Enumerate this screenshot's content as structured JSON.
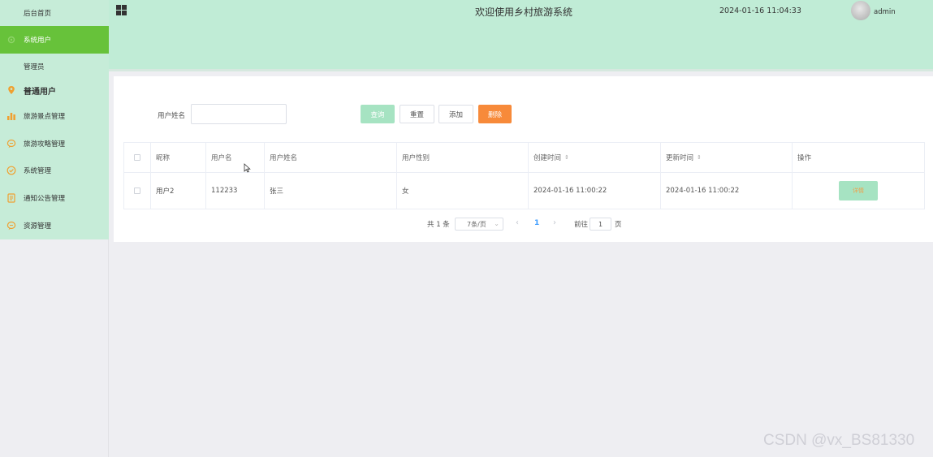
{
  "sidebar": {
    "items": [
      {
        "label": "后台首页",
        "icon": "none"
      },
      {
        "label": "系统用户",
        "icon": "gear-icon",
        "active": true
      },
      {
        "label": "管理员",
        "icon": "none"
      },
      {
        "label": "普通用户",
        "icon": "location-pin-icon"
      },
      {
        "label": "旅游景点管理",
        "icon": "bar-chart-icon"
      },
      {
        "label": "旅游攻略管理",
        "icon": "chat-bubble-icon"
      },
      {
        "label": "系统管理",
        "icon": "check-circle-icon"
      },
      {
        "label": "通知公告管理",
        "icon": "document-icon"
      },
      {
        "label": "资源管理",
        "icon": "chat-bubble-icon"
      }
    ]
  },
  "header": {
    "title": "欢迎使用乡村旅游系统",
    "datetime": "2024-01-16 11:04:33",
    "username": "admin"
  },
  "search": {
    "label": "用户姓名",
    "value": "",
    "query_label": "查询",
    "reset_label": "重置",
    "add_label": "添加",
    "delete_label": "删除"
  },
  "table": {
    "columns": [
      "昵称",
      "用户名",
      "用户姓名",
      "用户性别",
      "创建时间",
      "更新时间",
      "操作"
    ],
    "rows": [
      {
        "nickname": "用户2",
        "username": "112233",
        "name": "张三",
        "gender": "女",
        "created": "2024-01-16 11:00:22",
        "updated": "2024-01-16 11:00:22",
        "action": "详情"
      }
    ]
  },
  "pagination": {
    "total": "共 1 条",
    "page_size": "7条/页",
    "current": "1",
    "goto_label": "前往",
    "goto_value": "1",
    "page_suffix": "页"
  },
  "watermark": "CSDN @vx_BS81330",
  "colors": {
    "sidebar_bg": "#c6ecd8",
    "active": "#67c23a",
    "header_bg": "#c0ecd6",
    "primary_btn": "#a6e3c2",
    "delete_btn": "#f78a3a",
    "pin": "#f0a030"
  }
}
